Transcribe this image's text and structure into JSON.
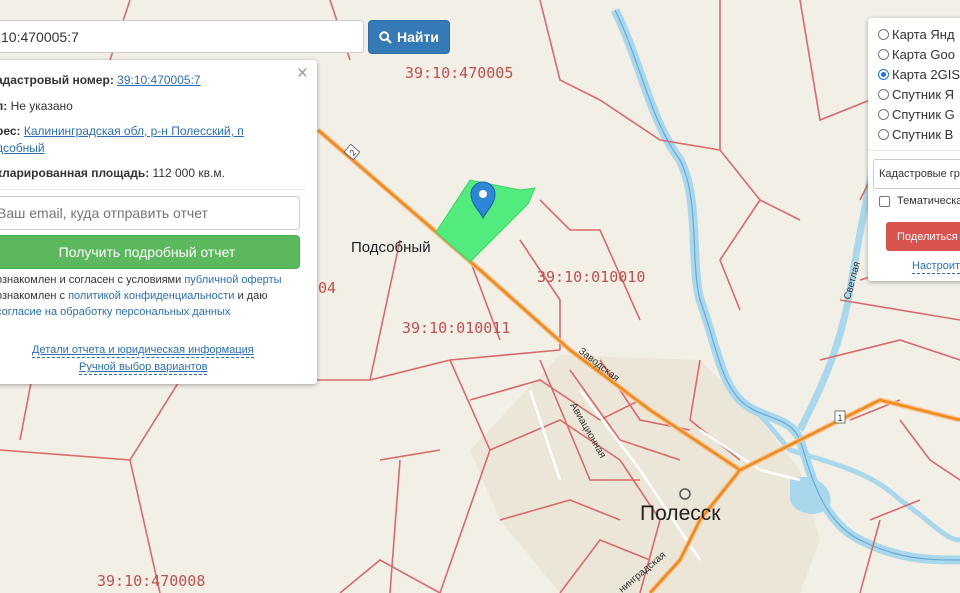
{
  "search": {
    "value": "10:470005:7",
    "button_label": "Найти"
  },
  "info_panel": {
    "cadastral_label": "адастровый номер:",
    "cadastral_value": "39:10:470005:7",
    "type_label": "п:",
    "type_value": "Не указано",
    "address_label": "рес:",
    "address_line1": "Калининградская обл, р-н Полесский, п",
    "address_line2": "дсобный",
    "area_label": "кларированная площадь:",
    "area_value": "112 000 кв.м.",
    "email_placeholder": "Ваш email, куда отправить отчет",
    "report_button": "Получить подробный отчет",
    "terms1_text": "ознакомлен и согласен с условиями",
    "terms1_link": "публичной оферты",
    "terms2_text": "ознакомлен с",
    "terms2_link": "политикой конфиденциальности",
    "terms2_tail": "и даю",
    "terms3_link": "согласие на обработку персональных данных",
    "details_link": "Детали отчета и юридическая информация",
    "manual_link": "Ручной выбор вариантов",
    "close_glyph": "×"
  },
  "layers": {
    "options": [
      {
        "label": "Карта Янд",
        "selected": false
      },
      {
        "label": "Карта Goo",
        "selected": false
      },
      {
        "label": "Карта 2GIS",
        "selected": true
      },
      {
        "label": "Спутник Я",
        "selected": false
      },
      {
        "label": "Спутник G",
        "selected": false
      },
      {
        "label": "Спутник B",
        "selected": false
      }
    ],
    "select_value": "Кадастровые гр",
    "thematic_label": "Тематическа",
    "share_button": "Поделиться",
    "settings_link": "Настроит"
  },
  "map": {
    "cadastral_labels": [
      "39:10:470005",
      "39:10:010010",
      "39:10:010011",
      "39:10:470008",
      "04"
    ],
    "places": {
      "village": "Подсобный",
      "town": "Полесск"
    },
    "streets": {
      "zavodskaya": "Заводская",
      "aviacionnaya": "Авиационная",
      "svetlaya": "Светлая",
      "leningradskaya": "нинградская"
    },
    "road_numbers": [
      "2",
      "1"
    ],
    "colors": {
      "parcel": "#52eb7d",
      "boundary": "#d96a6a",
      "road": "#f08a1c",
      "water": "#a9d8ec",
      "marker": "#2e86d9"
    }
  }
}
